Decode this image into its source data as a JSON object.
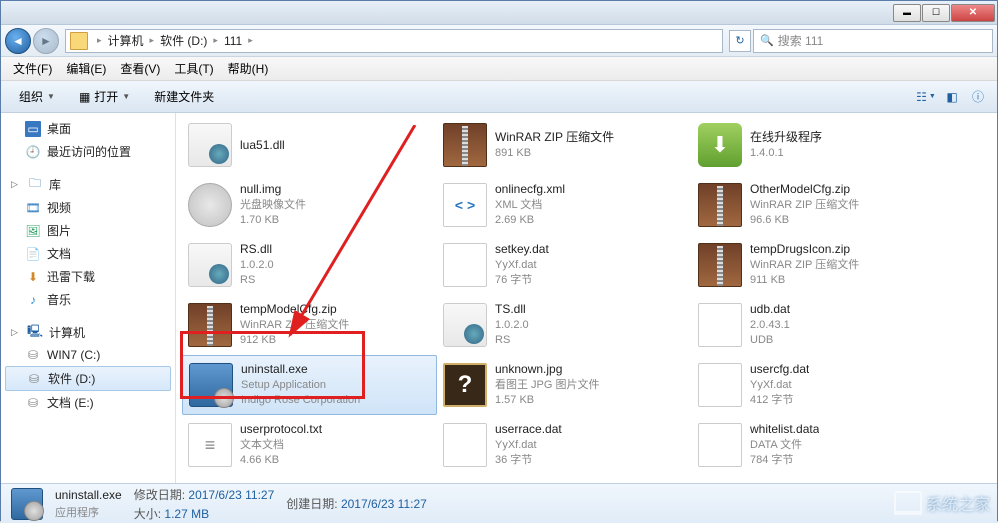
{
  "breadcrumb": {
    "root": "计算机",
    "drive": "软件 (D:)",
    "folder": "111"
  },
  "search": {
    "placeholder": "搜索 111"
  },
  "menu": {
    "file": "文件(F)",
    "edit": "编辑(E)",
    "view": "查看(V)",
    "tools": "工具(T)",
    "help": "帮助(H)"
  },
  "toolbar": {
    "org": "组织",
    "open": "打开",
    "newfolder": "新建文件夹"
  },
  "sidebar": {
    "fav": {
      "desktop": "桌面",
      "recent": "最近访问的位置"
    },
    "lib": {
      "header": "库",
      "video": "视频",
      "pic": "图片",
      "doc": "文档",
      "dl": "迅雷下载",
      "music": "音乐"
    },
    "comp": {
      "header": "计算机",
      "c": "WIN7 (C:)",
      "d": "软件 (D:)",
      "e": "文档 (E:)"
    }
  },
  "files": [
    {
      "name": "lua51.dll",
      "type": "",
      "size": "",
      "icon": "dll"
    },
    {
      "name": "null.img",
      "type": "光盘映像文件",
      "size": "1.70 KB",
      "icon": "img"
    },
    {
      "name": "RS.dll",
      "type": "1.0.2.0",
      "size": "RS",
      "icon": "dll"
    },
    {
      "name": "tempModelCfg.zip",
      "type": "WinRAR ZIP 压缩文件",
      "size": "912 KB",
      "icon": "zip"
    },
    {
      "name": "uninstall.exe",
      "type": "Setup Application",
      "size": "Indigo Rose Corporation",
      "icon": "exe",
      "selected": true
    },
    {
      "name": "userprotocol.txt",
      "type": "文本文档",
      "size": "4.66 KB",
      "icon": "txt"
    },
    {
      "name": "WinRAR ZIP 压缩文件",
      "type": "891 KB",
      "size": "",
      "icon": "zip"
    },
    {
      "name": "onlinecfg.xml",
      "type": "XML 文档",
      "size": "2.69 KB",
      "icon": "xml"
    },
    {
      "name": "setkey.dat",
      "type": "YyXf.dat",
      "size": "76 字节",
      "icon": "dat"
    },
    {
      "name": "TS.dll",
      "type": "1.0.2.0",
      "size": "RS",
      "icon": "dll"
    },
    {
      "name": "unknown.jpg",
      "type": "看图王 JPG 图片文件",
      "size": "1.57 KB",
      "icon": "unk"
    },
    {
      "name": "userrace.dat",
      "type": "YyXf.dat",
      "size": "36 字节",
      "icon": "dat"
    },
    {
      "name": "在线升级程序",
      "type": "1.4.0.1",
      "size": "",
      "icon": "update"
    },
    {
      "name": "OtherModelCfg.zip",
      "type": "WinRAR ZIP 压缩文件",
      "size": "96.6 KB",
      "icon": "zip"
    },
    {
      "name": "tempDrugsIcon.zip",
      "type": "WinRAR ZIP 压缩文件",
      "size": "911 KB",
      "icon": "zip"
    },
    {
      "name": "udb.dat",
      "type": "2.0.43.1",
      "size": "UDB",
      "icon": "dat"
    },
    {
      "name": "usercfg.dat",
      "type": "YyXf.dat",
      "size": "412 字节",
      "icon": "dat"
    },
    {
      "name": "whitelist.data",
      "type": "DATA 文件",
      "size": "784 字节",
      "icon": "dat"
    }
  ],
  "status": {
    "name": "uninstall.exe",
    "app": "应用程序",
    "mdate_label": "修改日期:",
    "mdate": "2017/6/23  11:27",
    "cdate_label": "创建日期:",
    "cdate": "2017/6/23  11:27",
    "size_label": "大小:",
    "size": "1.27 MB"
  },
  "watermark": "系统之家"
}
